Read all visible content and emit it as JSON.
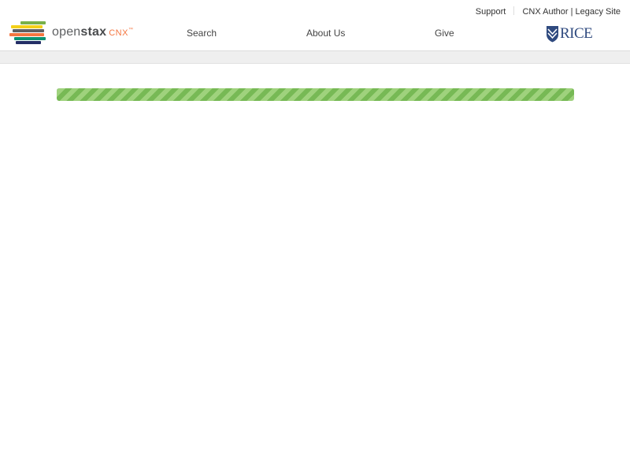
{
  "header": {
    "utility_links": [
      {
        "label": "Support"
      },
      {
        "label": "CNX Author | Legacy Site"
      }
    ],
    "logo": {
      "text_open": "open",
      "text_stax": "stax",
      "text_cnx": "CNX",
      "text_tm": "™",
      "stack_colors": [
        "#78b04a",
        "#f4d019",
        "#5e6062",
        "#f47641",
        "#0c9372",
        "#232e66"
      ]
    },
    "nav": [
      {
        "label": "Search"
      },
      {
        "label": "About Us"
      },
      {
        "label": "Give"
      }
    ],
    "rice_logo": {
      "text": "RICE",
      "color": "#2f4a7f",
      "icon": "rice-owl-shield-icon"
    }
  },
  "main": {
    "loading_progress": {
      "value_percent": 100,
      "color": "#7cbf5a"
    }
  }
}
